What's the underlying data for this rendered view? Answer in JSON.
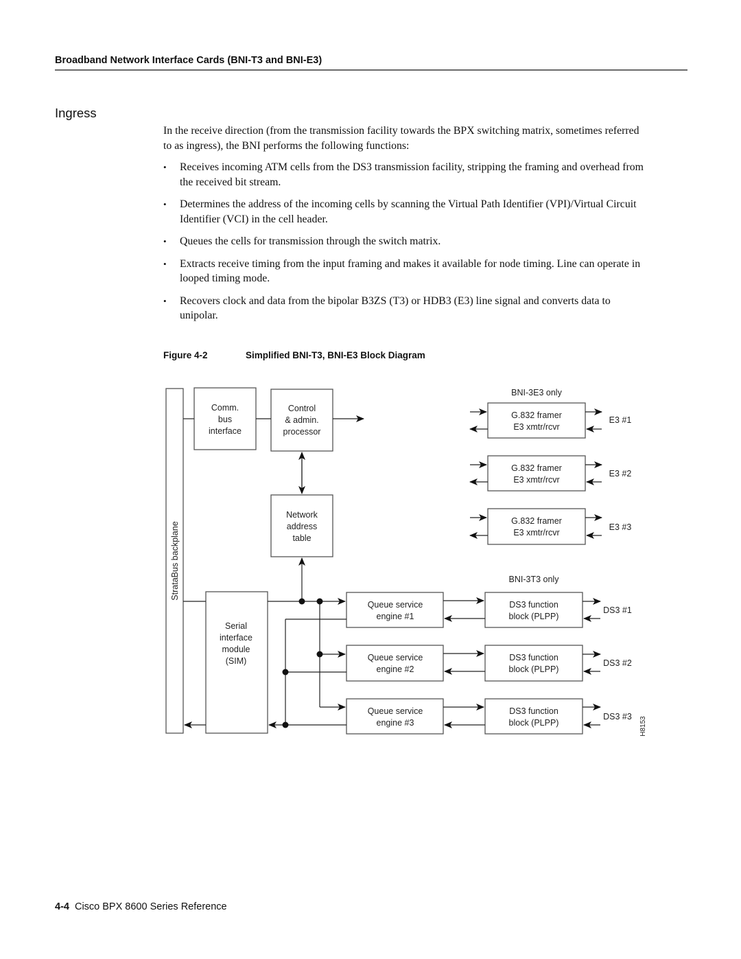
{
  "running_head": "Broadband Network Interface Cards (BNI-T3 and BNI-E3)",
  "section_title": "Ingress",
  "intro_paragraph": "In the receive direction (from the transmission facility towards the BPX switching matrix, sometimes referred to as ingress), the BNI performs the following functions:",
  "bullets": [
    "Receives incoming ATM cells from the DS3 transmission facility, stripping the framing and overhead from the received bit stream.",
    "Determines the address of the incoming cells by scanning the Virtual Path Identifier (VPI)/Virtual Circuit Identifier (VCI) in the cell header.",
    "Queues the cells for transmission through the switch matrix.",
    "Extracts receive timing from the input framing and makes it available for node timing. Line can operate in looped timing mode.",
    "Recovers clock and data from the bipolar B3ZS (T3) or HDB3 (E3) line signal and converts data to unipolar."
  ],
  "bullet_glyph": "•",
  "figure": {
    "number": "Figure 4-2",
    "title": "Simplified BNI-T3, BNI-E3 Block Diagram",
    "backplane_label": "StrataBus backplane",
    "comm_bus": [
      "Comm.",
      "bus",
      "interface"
    ],
    "control_proc": [
      "Control",
      "& admin.",
      "processor"
    ],
    "network_table": [
      "Network",
      "address",
      "table"
    ],
    "sim": [
      "Serial",
      "interface",
      "module",
      "(SIM)"
    ],
    "e3_group_label": "BNI-3E3 only",
    "e3_blocks": [
      {
        "line1": "G.832 framer",
        "line2": "E3 xmtr/rcvr",
        "port": "E3 #1"
      },
      {
        "line1": "G.832 framer",
        "line2": "E3 xmtr/rcvr",
        "port": "E3 #2"
      },
      {
        "line1": "G.832 framer",
        "line2": "E3 xmtr/rcvr",
        "port": "E3 #3"
      }
    ],
    "t3_group_label": "BNI-3T3 only",
    "queue_engines": [
      {
        "line1": "Queue service",
        "line2": "engine #1"
      },
      {
        "line1": "Queue service",
        "line2": "engine #2"
      },
      {
        "line1": "Queue service",
        "line2": "engine #3"
      }
    ],
    "ds3_blocks": [
      {
        "line1": "DS3 function",
        "line2": "block (PLPP)",
        "port": "DS3 #1"
      },
      {
        "line1": "DS3 function",
        "line2": "block (PLPP)",
        "port": "DS3 #2"
      },
      {
        "line1": "DS3 function",
        "line2": "block (PLPP)",
        "port": "DS3 #3"
      }
    ],
    "drawing_id": "H8153"
  },
  "footer": {
    "page_number": "4-4",
    "book_title": "Cisco BPX 8600 Series Reference"
  }
}
